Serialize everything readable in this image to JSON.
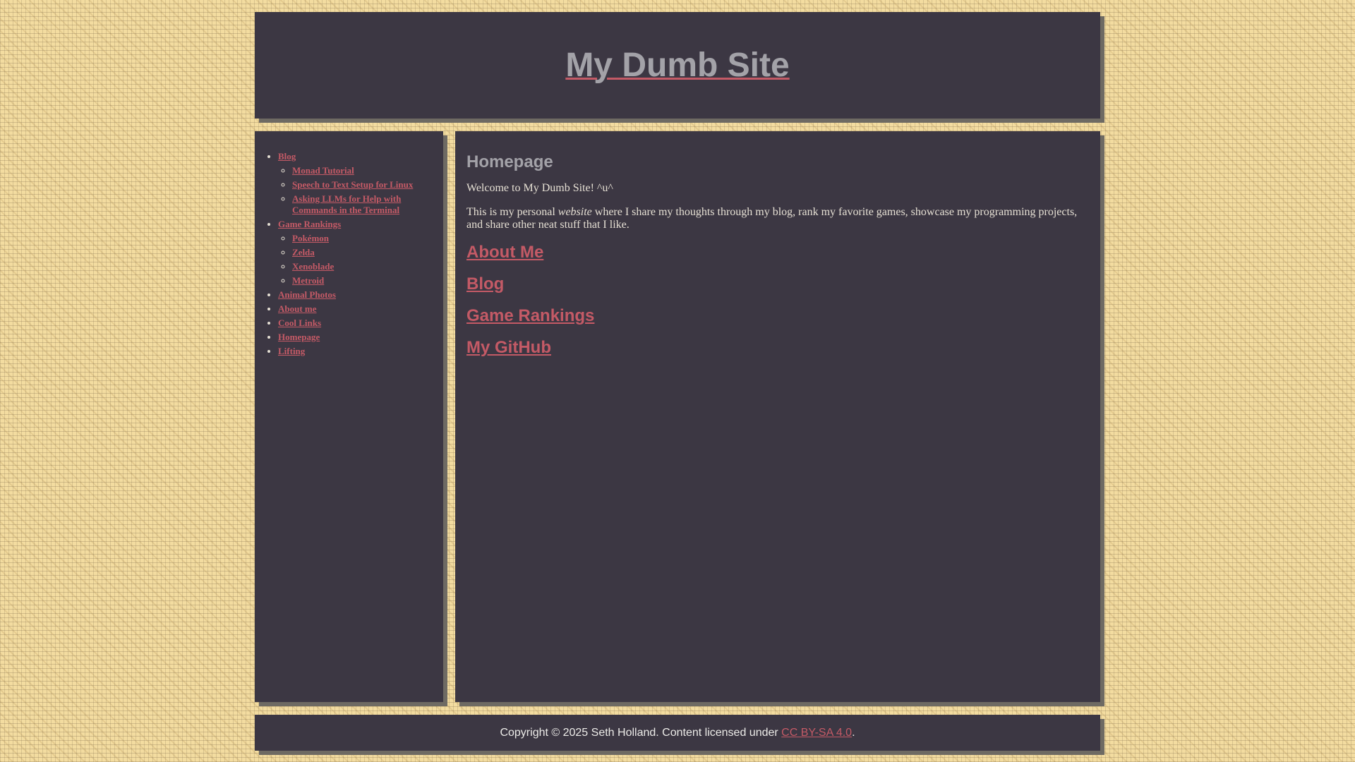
{
  "header": {
    "title": "My Dumb Site"
  },
  "sidebar": {
    "items": [
      {
        "label": "Blog",
        "children": [
          {
            "label": "Monad Tutorial"
          },
          {
            "label": "Speech to Text Setup for Linux"
          },
          {
            "label": "Asking LLMs for Help with Commands in the Terminal"
          }
        ]
      },
      {
        "label": "Game Rankings",
        "children": [
          {
            "label": "Pokémon"
          },
          {
            "label": "Zelda"
          },
          {
            "label": "Xenoblade"
          },
          {
            "label": "Metroid"
          }
        ]
      },
      {
        "label": "Animal Photos"
      },
      {
        "label": "About me"
      },
      {
        "label": "Cool Links"
      },
      {
        "label": "Homepage"
      },
      {
        "label": "Lifting"
      }
    ]
  },
  "main": {
    "heading": "Homepage",
    "welcome": "Welcome to My Dumb Site! ^u^",
    "intro_before": "This is my personal ",
    "intro_emphasis": "website",
    "intro_after": " where I share my thoughts through my blog, rank my favorite games, showcase my programming projects, and share other neat stuff that I like.",
    "links": [
      {
        "label": "About Me"
      },
      {
        "label": "Blog"
      },
      {
        "label": "Game Rankings"
      },
      {
        "label": "My GitHub"
      }
    ]
  },
  "footer": {
    "text": "Copyright © 2025 Seth Holland. Content licensed under ",
    "license_label": "CC BY-SA 4.0",
    "suffix": "."
  },
  "colors": {
    "background": "#f3dca0",
    "panel": "#3c3743",
    "link": "#c45a66",
    "heading": "#a3a2a8",
    "text": "#e6e0d4"
  }
}
